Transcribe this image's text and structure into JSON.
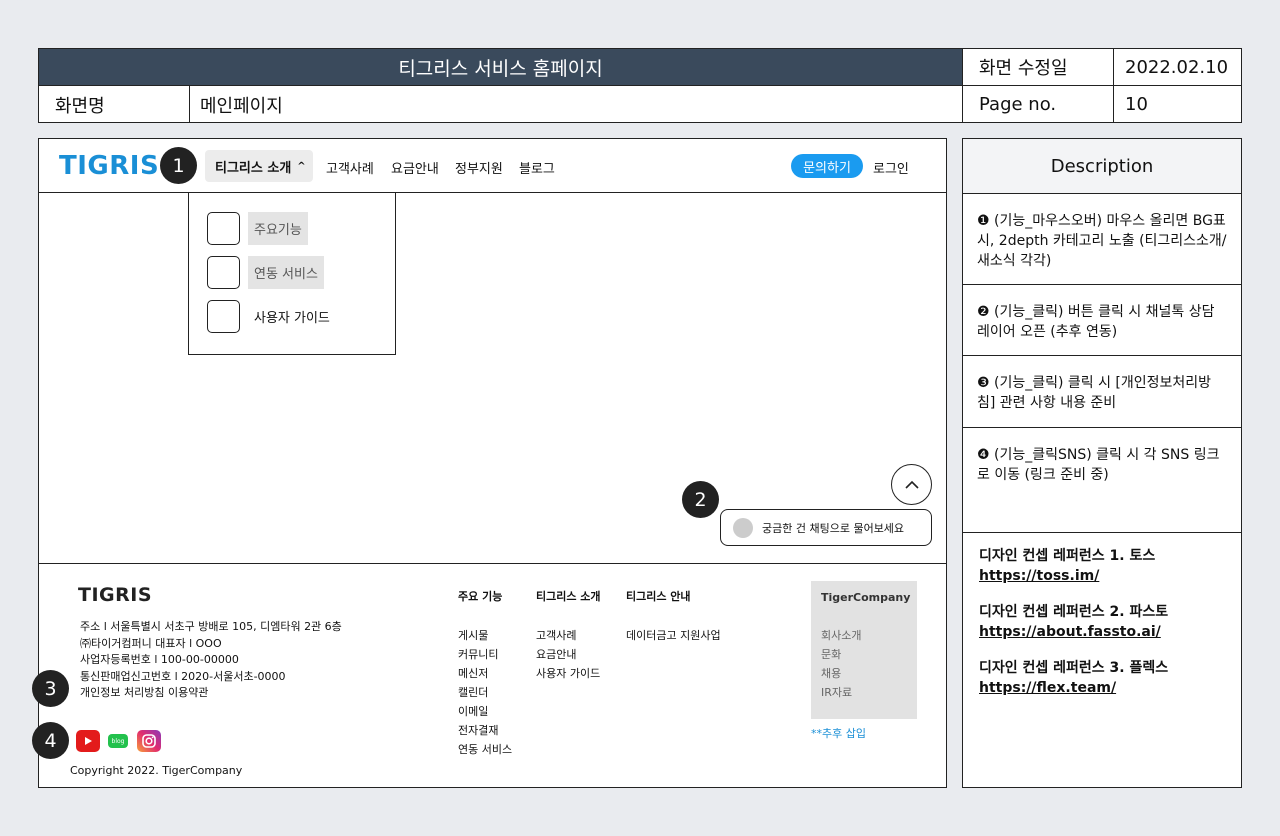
{
  "header": {
    "title": "티그리스 서비스 홈페이지",
    "modified_label": "화면 수정일",
    "modified_value": "2022.02.10",
    "screen_name_label": "화면명",
    "screen_name_value": "메인페이지",
    "page_label": "Page no.",
    "page_value": "10"
  },
  "site": {
    "logo": "TIGRIS",
    "nav": {
      "active_label": "티그리스 소개",
      "active_chevron": "^",
      "items": [
        "고객사례",
        "요금안내",
        "정부지원",
        "블로그"
      ],
      "inquiry_button": "문의하기",
      "login": "로그인"
    },
    "dropdown": [
      {
        "label": "주요기능",
        "highlighted": true
      },
      {
        "label": "연동 서비스",
        "highlighted": true
      },
      {
        "label": "사용자 가이드",
        "highlighted": false
      }
    ],
    "top_button": "^",
    "chat_text": "궁금한 건 채팅으로 물어보세요",
    "badges": [
      "1",
      "2",
      "3",
      "4"
    ]
  },
  "footer": {
    "logo": "TIGRIS",
    "info": [
      "주소 l 서울특별시 서초구 방배로 105, 디엠타워 2관 6층",
      "㈜타이거컴퍼니 대표자 l  OOO",
      "사업자등록번호 l  100-00-00000",
      "통신판매업신고번호 l  2020-서울서초-0000",
      "개인정보 처리방침  이용약관"
    ],
    "sns_icons": [
      "youtube-icon",
      "blog-icon",
      "instagram-icon"
    ],
    "blog_text": "blog",
    "copyright": "Copyright 2022. TigerCompany",
    "col1": {
      "heading": "주요 기능",
      "items": [
        "게시물",
        "커뮤니티",
        "메신저",
        "캘린더",
        "이메일",
        "전자결재",
        "연동 서비스"
      ]
    },
    "col2": {
      "heading": "티그리스 소개",
      "items": [
        "고객사례",
        "요금안내",
        "사용자 가이드"
      ]
    },
    "col3": {
      "heading": "티그리스 안내",
      "items": [
        "데이터금고 지원사업"
      ]
    },
    "tiger": {
      "heading": "TigerCompany",
      "items": [
        "회사소개",
        "문화",
        "채용",
        "IR자료"
      ]
    },
    "later_note": "**추후 삽입"
  },
  "description": {
    "heading": "Description",
    "items": [
      "❶ (기능_마우스오버) 마우스 올리면 BG표시, 2depth 카테고리 노출 (티그리스소개/새소식 각각)",
      "❷ (기능_클릭) 버튼 클릭 시 채널톡 상담 레이어 오픈 (추후 연동)",
      "❸ (기능_클릭) 클릭 시 [개인정보처리방침] 관련 사항 내용 준비",
      "❹ (기능_클릭SNS) 클릭 시 각 SNS 링크로 이동 (링크 준비 중)"
    ],
    "refs": [
      {
        "title": "디자인 컨셉 레퍼런스 1. 토스",
        "url": "https://toss.im/"
      },
      {
        "title": "디자인 컨셉 레퍼런스 2. 파스토",
        "url": "https://about.fassto.ai/"
      },
      {
        "title": "디자인 컨셉 레퍼런스 3.  플렉스",
        "url": "https://flex.team/"
      }
    ]
  },
  "colors": {
    "brand": "#1a8fd6",
    "header_bg": "#3a4a5c",
    "inquiry": "#1a9bf0"
  }
}
